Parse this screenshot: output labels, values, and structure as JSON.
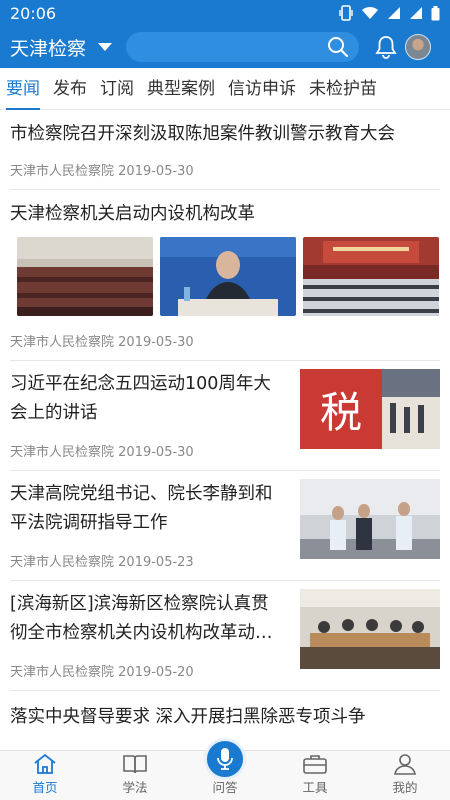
{
  "status": {
    "time": "20:06"
  },
  "header": {
    "title": "天津检察",
    "search_placeholder": ""
  },
  "tabs": [
    {
      "label": "要闻",
      "active": true
    },
    {
      "label": "发布"
    },
    {
      "label": "订阅"
    },
    {
      "label": "典型案例"
    },
    {
      "label": "信访申诉"
    },
    {
      "label": "未检护苗"
    }
  ],
  "feed": [
    {
      "title": "市检察院召开深刻汲取陈旭案件教训警示教育大会",
      "source": "天津市人民检察院",
      "date": "2019-05-30"
    },
    {
      "title": "天津检察机关启动内设机构改革",
      "source": "天津市人民检察院",
      "date": "2019-05-30"
    },
    {
      "title": "习近平在纪念五四运动100周年大会上的讲话",
      "source": "天津市人民检察院",
      "date": "2019-05-30",
      "thumb_text": "税"
    },
    {
      "title": "天津高院党组书记、院长李静到和平法院调研指导工作",
      "source": "天津市人民检察院",
      "date": "2019-05-23"
    },
    {
      "title": "[滨海新区]滨海新区检察院认真贯彻全市检察机关内设机构改革动…",
      "source": "天津市人民检察院",
      "date": "2019-05-20"
    },
    {
      "title": "落实中央督导要求 深入开展扫黑除恶专项斗争"
    }
  ],
  "nav": [
    {
      "label": "首页",
      "icon": "home-icon",
      "active": true
    },
    {
      "label": "学法",
      "icon": "book-icon"
    },
    {
      "label": "问答",
      "icon": "mic-icon"
    },
    {
      "label": "工具",
      "icon": "toolbox-icon"
    },
    {
      "label": "我的",
      "icon": "user-icon"
    }
  ],
  "colors": {
    "primary": "#1a7ad0",
    "text": "#222222",
    "meta": "#888888"
  }
}
